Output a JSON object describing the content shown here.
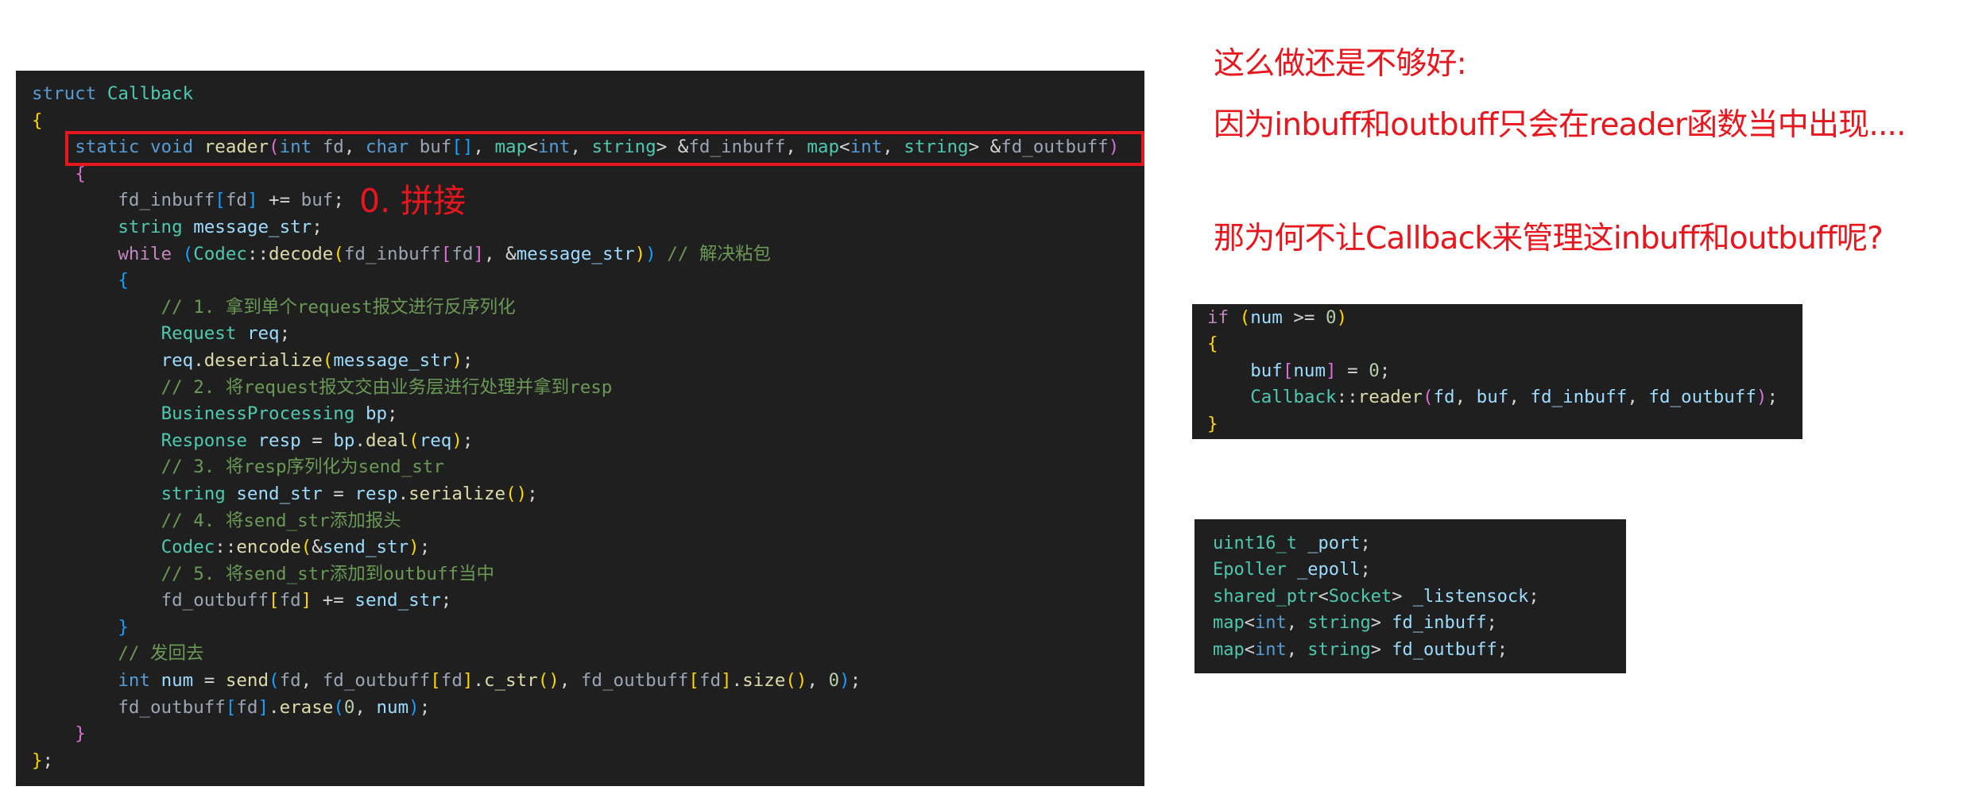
{
  "main_code": {
    "lines": [
      [
        [
          "kw",
          "struct"
        ],
        [
          "pl",
          " "
        ],
        [
          "ty",
          "Callback"
        ]
      ],
      [
        [
          "b1",
          "{"
        ]
      ],
      [
        [
          "pl",
          "    "
        ],
        [
          "kw",
          "static"
        ],
        [
          "pl",
          " "
        ],
        [
          "kw",
          "void"
        ],
        [
          "pl",
          " "
        ],
        [
          "fn",
          "reader"
        ],
        [
          "b2",
          "("
        ],
        [
          "kw",
          "int"
        ],
        [
          "pl",
          " "
        ],
        [
          "par",
          "fd"
        ],
        [
          "pl",
          ", "
        ],
        [
          "kw",
          "char"
        ],
        [
          "pl",
          " "
        ],
        [
          "par",
          "buf"
        ],
        [
          "b3",
          "[]"
        ],
        [
          "pl",
          ", "
        ],
        [
          "ty",
          "map"
        ],
        [
          "pl",
          "<"
        ],
        [
          "kw",
          "int"
        ],
        [
          "pl",
          ", "
        ],
        [
          "ty",
          "string"
        ],
        [
          "pl",
          "> &"
        ],
        [
          "par",
          "fd_inbuff"
        ],
        [
          "pl",
          ", "
        ],
        [
          "ty",
          "map"
        ],
        [
          "pl",
          "<"
        ],
        [
          "kw",
          "int"
        ],
        [
          "pl",
          ", "
        ],
        [
          "ty",
          "string"
        ],
        [
          "pl",
          "> &"
        ],
        [
          "par",
          "fd_outbuff"
        ],
        [
          "b2",
          ")"
        ]
      ],
      [
        [
          "pl",
          "    "
        ],
        [
          "b2",
          "{"
        ]
      ],
      [
        [
          "pl",
          "        "
        ],
        [
          "par",
          "fd_inbuff"
        ],
        [
          "b3",
          "["
        ],
        [
          "par",
          "fd"
        ],
        [
          "b3",
          "]"
        ],
        [
          "pl",
          " += "
        ],
        [
          "par",
          "buf"
        ],
        [
          "pl",
          ";"
        ]
      ],
      [
        [
          "pl",
          "        "
        ],
        [
          "ty",
          "string"
        ],
        [
          "pl",
          " "
        ],
        [
          "var",
          "message_str"
        ],
        [
          "pl",
          ";"
        ]
      ],
      [
        [
          "pl",
          "        "
        ],
        [
          "ctl",
          "while"
        ],
        [
          "pl",
          " "
        ],
        [
          "b3",
          "("
        ],
        [
          "ty",
          "Codec"
        ],
        [
          "pl",
          "::"
        ],
        [
          "fn",
          "decode"
        ],
        [
          "b1",
          "("
        ],
        [
          "par",
          "fd_inbuff"
        ],
        [
          "b2",
          "["
        ],
        [
          "par",
          "fd"
        ],
        [
          "b2",
          "]"
        ],
        [
          "pl",
          ", &"
        ],
        [
          "var",
          "message_str"
        ],
        [
          "b1",
          ")"
        ],
        [
          "b3",
          ")"
        ],
        [
          "pl",
          " "
        ],
        [
          "cm",
          "// 解决粘包"
        ]
      ],
      [
        [
          "pl",
          "        "
        ],
        [
          "b3",
          "{"
        ]
      ],
      [
        [
          "pl",
          "            "
        ],
        [
          "cm",
          "// 1. 拿到单个request报文进行反序列化"
        ]
      ],
      [
        [
          "pl",
          "            "
        ],
        [
          "ty",
          "Request"
        ],
        [
          "pl",
          " "
        ],
        [
          "var",
          "req"
        ],
        [
          "pl",
          ";"
        ]
      ],
      [
        [
          "pl",
          "            "
        ],
        [
          "var",
          "req"
        ],
        [
          "pl",
          "."
        ],
        [
          "fn",
          "deserialize"
        ],
        [
          "b1",
          "("
        ],
        [
          "var",
          "message_str"
        ],
        [
          "b1",
          ")"
        ],
        [
          "pl",
          ";"
        ]
      ],
      [
        [
          "pl",
          "            "
        ],
        [
          "cm",
          "// 2. 将request报文交由业务层进行处理并拿到resp"
        ]
      ],
      [
        [
          "pl",
          "            "
        ],
        [
          "ty",
          "BusinessProcessing"
        ],
        [
          "pl",
          " "
        ],
        [
          "var",
          "bp"
        ],
        [
          "pl",
          ";"
        ]
      ],
      [
        [
          "pl",
          "            "
        ],
        [
          "ty",
          "Response"
        ],
        [
          "pl",
          " "
        ],
        [
          "var",
          "resp"
        ],
        [
          "pl",
          " = "
        ],
        [
          "var",
          "bp"
        ],
        [
          "pl",
          "."
        ],
        [
          "fn",
          "deal"
        ],
        [
          "b1",
          "("
        ],
        [
          "var",
          "req"
        ],
        [
          "b1",
          ")"
        ],
        [
          "pl",
          ";"
        ]
      ],
      [
        [
          "pl",
          "            "
        ],
        [
          "cm",
          "// 3. 将resp序列化为send_str"
        ]
      ],
      [
        [
          "pl",
          "            "
        ],
        [
          "ty",
          "string"
        ],
        [
          "pl",
          " "
        ],
        [
          "var",
          "send_str"
        ],
        [
          "pl",
          " = "
        ],
        [
          "var",
          "resp"
        ],
        [
          "pl",
          "."
        ],
        [
          "fn",
          "serialize"
        ],
        [
          "b1",
          "()"
        ],
        [
          "pl",
          ";"
        ]
      ],
      [
        [
          "pl",
          "            "
        ],
        [
          "cm",
          "// 4. 将send_str添加报头"
        ]
      ],
      [
        [
          "pl",
          "            "
        ],
        [
          "ty",
          "Codec"
        ],
        [
          "pl",
          "::"
        ],
        [
          "fn",
          "encode"
        ],
        [
          "b1",
          "("
        ],
        [
          "pl",
          "&"
        ],
        [
          "var",
          "send_str"
        ],
        [
          "b1",
          ")"
        ],
        [
          "pl",
          ";"
        ]
      ],
      [
        [
          "pl",
          "            "
        ],
        [
          "cm",
          "// 5. 将send_str添加到outbuff当中"
        ]
      ],
      [
        [
          "pl",
          "            "
        ],
        [
          "par",
          "fd_outbuff"
        ],
        [
          "b1",
          "["
        ],
        [
          "par",
          "fd"
        ],
        [
          "b1",
          "]"
        ],
        [
          "pl",
          " += "
        ],
        [
          "var",
          "send_str"
        ],
        [
          "pl",
          ";"
        ]
      ],
      [
        [
          "pl",
          "        "
        ],
        [
          "b3",
          "}"
        ]
      ],
      [
        [
          "pl",
          "        "
        ],
        [
          "cm",
          "// 发回去"
        ]
      ],
      [
        [
          "pl",
          "        "
        ],
        [
          "kw",
          "int"
        ],
        [
          "pl",
          " "
        ],
        [
          "var",
          "num"
        ],
        [
          "pl",
          " = "
        ],
        [
          "fn",
          "send"
        ],
        [
          "b3",
          "("
        ],
        [
          "par",
          "fd"
        ],
        [
          "pl",
          ", "
        ],
        [
          "par",
          "fd_outbuff"
        ],
        [
          "b1",
          "["
        ],
        [
          "par",
          "fd"
        ],
        [
          "b1",
          "]"
        ],
        [
          "pl",
          "."
        ],
        [
          "fn",
          "c_str"
        ],
        [
          "b1",
          "()"
        ],
        [
          "pl",
          ", "
        ],
        [
          "par",
          "fd_outbuff"
        ],
        [
          "b1",
          "["
        ],
        [
          "par",
          "fd"
        ],
        [
          "b1",
          "]"
        ],
        [
          "pl",
          "."
        ],
        [
          "fn",
          "size"
        ],
        [
          "b1",
          "()"
        ],
        [
          "pl",
          ", "
        ],
        [
          "num",
          "0"
        ],
        [
          "b3",
          ")"
        ],
        [
          "pl",
          ";"
        ]
      ],
      [
        [
          "pl",
          "        "
        ],
        [
          "par",
          "fd_outbuff"
        ],
        [
          "b3",
          "["
        ],
        [
          "par",
          "fd"
        ],
        [
          "b3",
          "]"
        ],
        [
          "pl",
          "."
        ],
        [
          "fn",
          "erase"
        ],
        [
          "b3",
          "("
        ],
        [
          "num",
          "0"
        ],
        [
          "pl",
          ", "
        ],
        [
          "var",
          "num"
        ],
        [
          "b3",
          ")"
        ],
        [
          "pl",
          ";"
        ]
      ],
      [
        [
          "pl",
          "    "
        ],
        [
          "b2",
          "}"
        ]
      ],
      [
        [
          "b1",
          "}"
        ],
        [
          "pl",
          ";"
        ]
      ]
    ]
  },
  "annotation": {
    "step_label": "0. 拼接"
  },
  "notes": {
    "line1": "这么做还是不够好:",
    "line2": "因为inbuff和outbuff只会在reader函数当中出现....",
    "line3": "那为何不让Callback来管理这inbuff和outbuff呢?"
  },
  "call_snippet": {
    "lines": [
      [
        [
          "ctl",
          "if"
        ],
        [
          "pl",
          " "
        ],
        [
          "b1",
          "("
        ],
        [
          "var",
          "num"
        ],
        [
          "pl",
          " >= "
        ],
        [
          "num",
          "0"
        ],
        [
          "b1",
          ")"
        ]
      ],
      [
        [
          "b1",
          "{"
        ]
      ],
      [
        [
          "pl",
          "    "
        ],
        [
          "var",
          "buf"
        ],
        [
          "b2",
          "["
        ],
        [
          "var",
          "num"
        ],
        [
          "b2",
          "]"
        ],
        [
          "pl",
          " = "
        ],
        [
          "num",
          "0"
        ],
        [
          "pl",
          ";"
        ]
      ],
      [
        [
          "pl",
          "    "
        ],
        [
          "ty",
          "Callback"
        ],
        [
          "pl",
          "::"
        ],
        [
          "fn",
          "reader"
        ],
        [
          "b2",
          "("
        ],
        [
          "var",
          "fd"
        ],
        [
          "pl",
          ", "
        ],
        [
          "var",
          "buf"
        ],
        [
          "pl",
          ", "
        ],
        [
          "var",
          "fd_inbuff"
        ],
        [
          "pl",
          ", "
        ],
        [
          "var",
          "fd_outbuff"
        ],
        [
          "b2",
          ")"
        ],
        [
          "pl",
          ";"
        ]
      ],
      [
        [
          "b1",
          "}"
        ]
      ]
    ]
  },
  "members_snippet": {
    "lines": [
      [
        [
          "ty",
          "uint16_t"
        ],
        [
          "pl",
          " "
        ],
        [
          "var",
          "_port"
        ],
        [
          "pl",
          ";"
        ]
      ],
      [
        [
          "ty",
          "Epoller"
        ],
        [
          "pl",
          " "
        ],
        [
          "var",
          "_epoll"
        ],
        [
          "pl",
          ";"
        ]
      ],
      [
        [
          "ty",
          "shared_ptr"
        ],
        [
          "pl",
          "<"
        ],
        [
          "ty",
          "Socket"
        ],
        [
          "pl",
          "> "
        ],
        [
          "var",
          "_listensock"
        ],
        [
          "pl",
          ";"
        ]
      ],
      [
        [
          "ty",
          "map"
        ],
        [
          "pl",
          "<"
        ],
        [
          "kw",
          "int"
        ],
        [
          "pl",
          ", "
        ],
        [
          "ty",
          "string"
        ],
        [
          "pl",
          "> "
        ],
        [
          "var",
          "fd_inbuff"
        ],
        [
          "pl",
          ";"
        ]
      ],
      [
        [
          "ty",
          "map"
        ],
        [
          "pl",
          "<"
        ],
        [
          "kw",
          "int"
        ],
        [
          "pl",
          ", "
        ],
        [
          "ty",
          "string"
        ],
        [
          "pl",
          "> "
        ],
        [
          "var",
          "fd_outbuff"
        ],
        [
          "pl",
          ";"
        ]
      ]
    ]
  }
}
